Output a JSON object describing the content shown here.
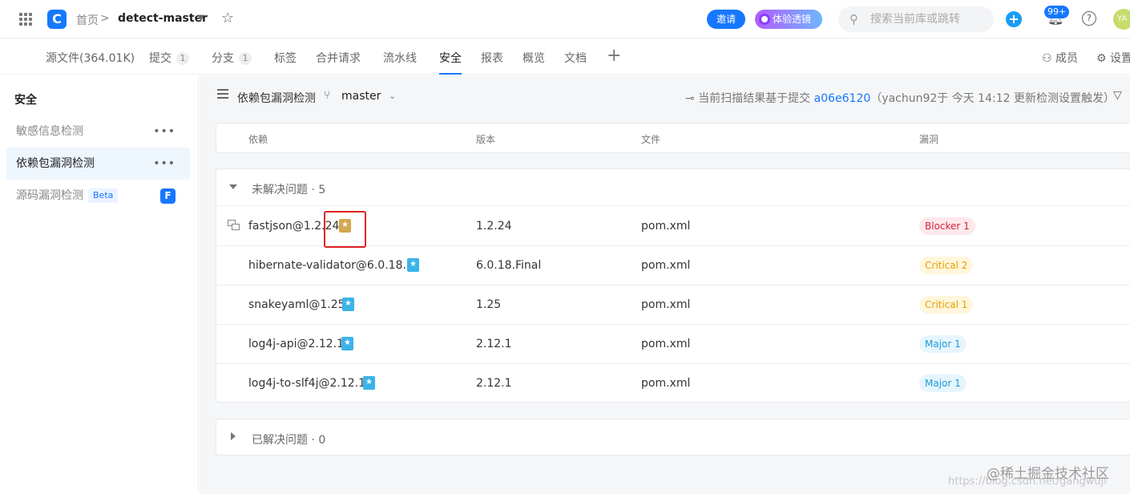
{
  "header": {
    "logo": "C",
    "breadcrumb_home": "首页",
    "breadcrumb_sep": ">",
    "repo_name": "detect-master",
    "invite_label": "邀请",
    "lens_label": "体验透镜",
    "search_placeholder": "搜索当前库或跳转",
    "notification_count": "99+",
    "help": "?",
    "avatar_initials": "YA"
  },
  "tabs": [
    {
      "label": "源文件(364.01K)",
      "count": ""
    },
    {
      "label": "提交",
      "count": "1"
    },
    {
      "label": "分支",
      "count": "1"
    },
    {
      "label": "标签",
      "count": ""
    },
    {
      "label": "合并请求",
      "count": ""
    },
    {
      "label": "流水线",
      "count": ""
    },
    {
      "label": "安全",
      "count": "",
      "active": true
    },
    {
      "label": "报表",
      "count": ""
    },
    {
      "label": "概览",
      "count": ""
    },
    {
      "label": "文档",
      "count": ""
    }
  ],
  "tab_actions": {
    "members": "成员",
    "settings": "设置"
  },
  "sidebar": {
    "title": "安全",
    "items": [
      {
        "label": "敏感信息检测",
        "more": "•••"
      },
      {
        "label": "依赖包漏洞检测",
        "more": "•••",
        "active": true
      },
      {
        "label": "源码漏洞检测",
        "badge": "Beta",
        "icon": "F"
      }
    ]
  },
  "toolbar": {
    "title": "依赖包漏洞检测",
    "branch": "master",
    "commit_prefix": "当前扫描结果基于提交",
    "commit_hash": "a06e6120",
    "commit_suffix": "（yachun92于 今天 14:12 更新检测设置触发）"
  },
  "table": {
    "columns": [
      "依赖",
      "版本",
      "文件",
      "漏洞"
    ],
    "unresolved_label": "未解决问题 · 5",
    "rows": [
      {
        "dependency": "fastjson@1.2.24",
        "version": "1.2.24",
        "file": "pom.xml",
        "severity": "Blocker 1",
        "level": "blocker",
        "bookmark": "gold"
      },
      {
        "dependency": "hibernate-validator@6.0.18...",
        "version": "6.0.18.Final",
        "file": "pom.xml",
        "severity": "Critical 2",
        "level": "critical",
        "bookmark": "blue"
      },
      {
        "dependency": "snakeyaml@1.25",
        "version": "1.25",
        "file": "pom.xml",
        "severity": "Critical 1",
        "level": "critical",
        "bookmark": "blue"
      },
      {
        "dependency": "log4j-api@2.12.1",
        "version": "2.12.1",
        "file": "pom.xml",
        "severity": "Major 1",
        "level": "major",
        "bookmark": "blue"
      },
      {
        "dependency": "log4j-to-slf4j@2.12.1",
        "version": "2.12.1",
        "file": "pom.xml",
        "severity": "Major 1",
        "level": "major",
        "bookmark": "blue"
      }
    ],
    "resolved_label": "已解决问题 · 0"
  },
  "watermark": "@稀土掘金技术社区",
  "watermark_url": "https://blog.csdn.net/gangwuji"
}
